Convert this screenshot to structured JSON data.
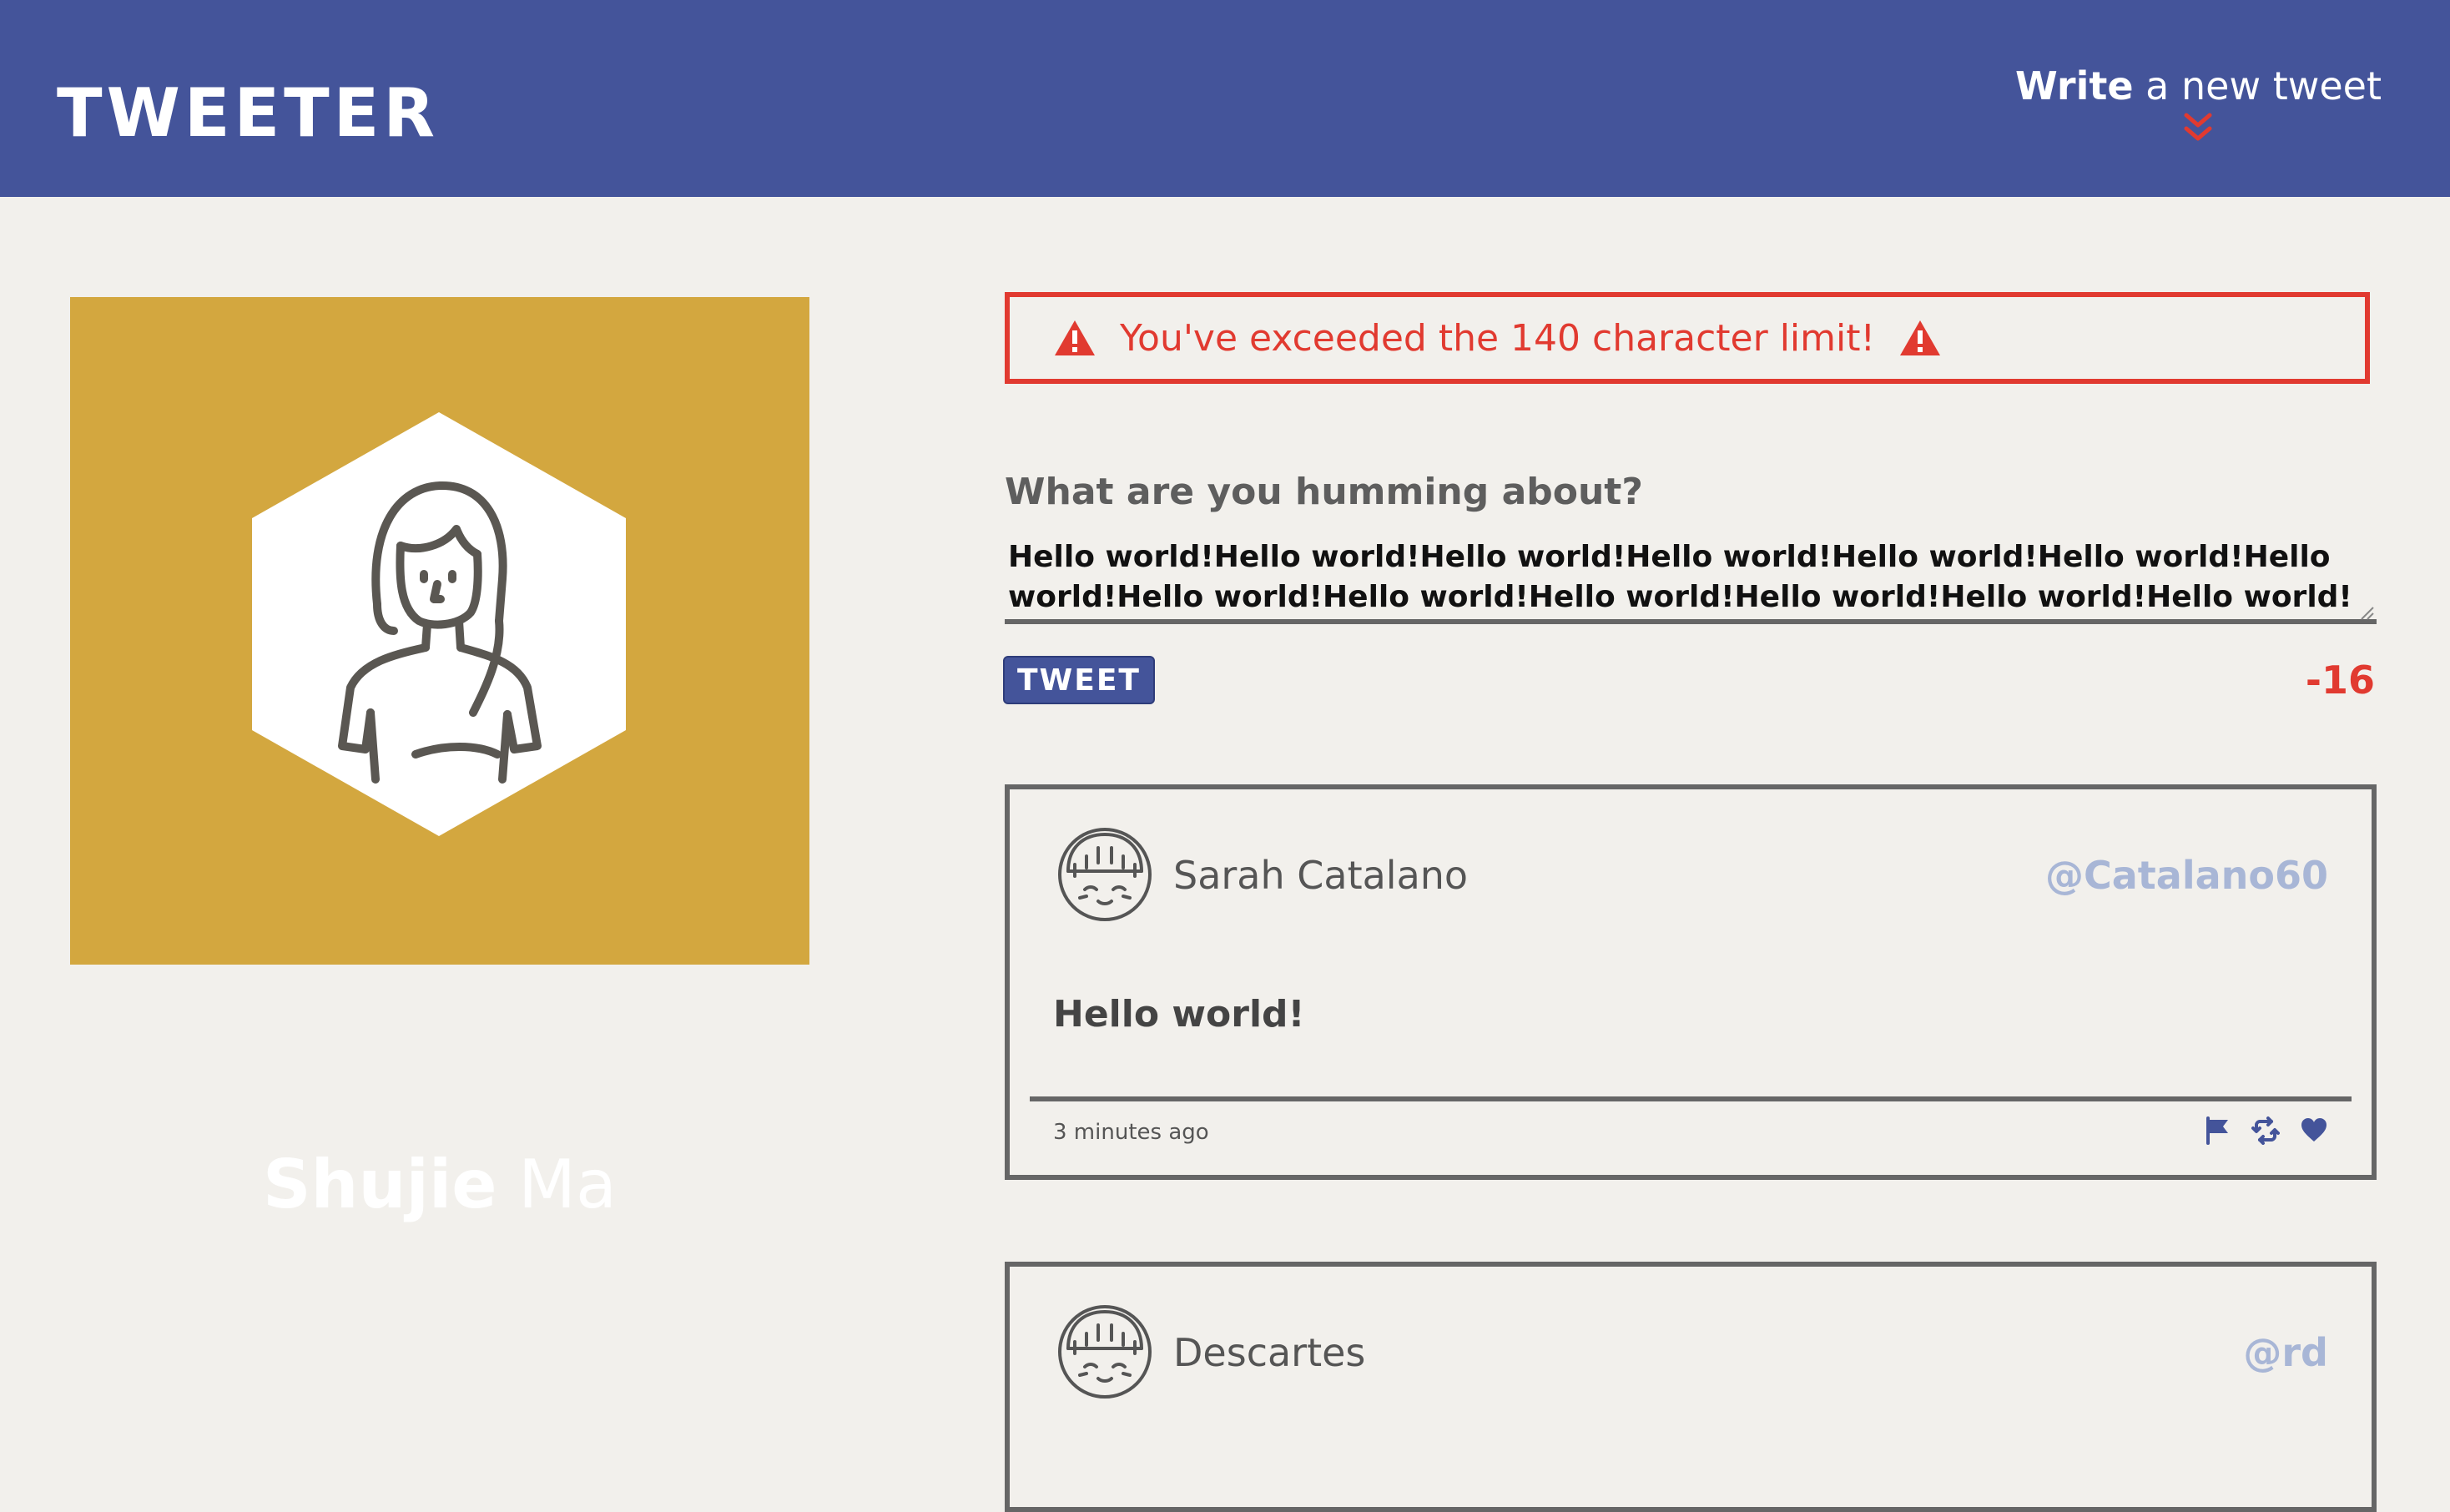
{
  "nav": {
    "logo": "TWEETER",
    "compose_bold": "Write",
    "compose_rest": " a new tweet",
    "compose_icon": "chevron-double-down-icon"
  },
  "profile": {
    "first_name": "Shujie",
    "last_name": "Ma",
    "avatar_icon": "woman-avatar-icon"
  },
  "error": {
    "message": "You've exceeded the 140 character limit!",
    "icon": "warning-icon"
  },
  "form": {
    "prompt": "What are you humming about?",
    "text": "Hello world!Hello world!Hello world!Hello world!Hello world!Hello world!Hello world!Hello world!Hello world!Hello world!Hello world!Hello world!Hello world!",
    "button_label": "TWEET",
    "counter": "-16"
  },
  "tweets": [
    {
      "user": "Sarah Catalano",
      "handle": "@Catalano60",
      "content": "Hello world!",
      "time": "3 minutes ago",
      "actions": [
        "flag-icon",
        "retweet-icon",
        "heart-icon"
      ]
    },
    {
      "user": "Descartes",
      "handle": "@rd"
    }
  ],
  "colors": {
    "nav": "#44549a",
    "page": "#f2f0ec",
    "profile": "#d3a73f",
    "error": "#e13a30",
    "handle": "#a8b6d6"
  }
}
